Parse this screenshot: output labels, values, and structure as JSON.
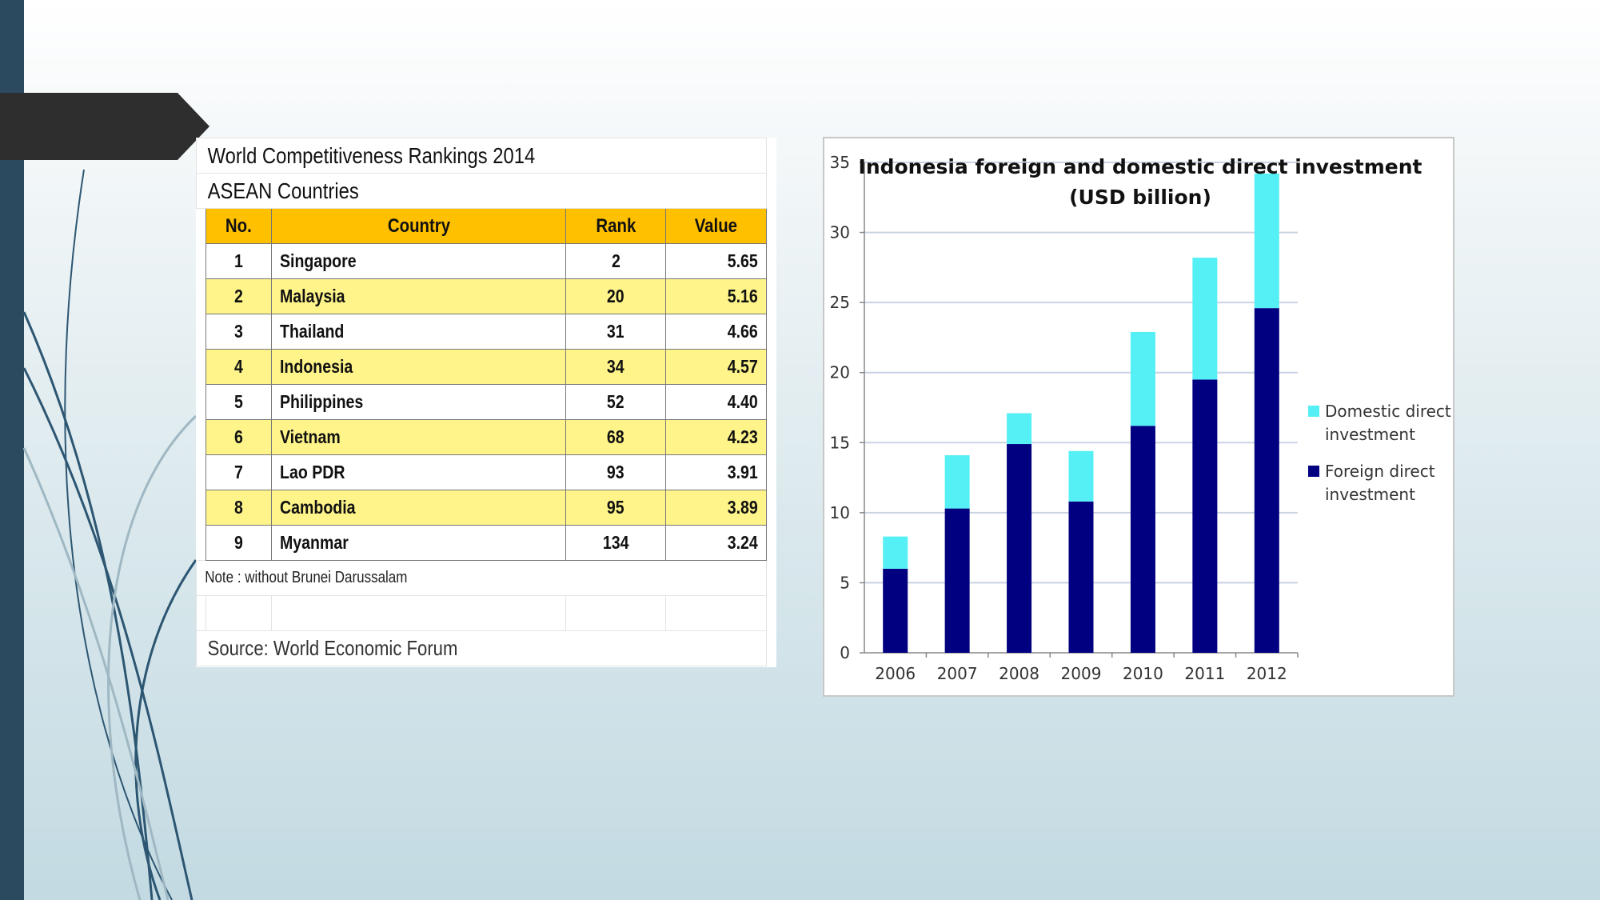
{
  "table": {
    "title": "World Competitiveness Rankings 2014",
    "subtitle": "ASEAN Countries",
    "headers": [
      "No.",
      "Country",
      "Rank",
      "Value"
    ],
    "rows": [
      {
        "no": "1",
        "country": "Singapore",
        "rank": "2",
        "value": "5.65"
      },
      {
        "no": "2",
        "country": "Malaysia",
        "rank": "20",
        "value": "5.16"
      },
      {
        "no": "3",
        "country": "Thailand",
        "rank": "31",
        "value": "4.66"
      },
      {
        "no": "4",
        "country": "Indonesia",
        "rank": "34",
        "value": "4.57"
      },
      {
        "no": "5",
        "country": "Philippines",
        "rank": "52",
        "value": "4.40"
      },
      {
        "no": "6",
        "country": "Vietnam",
        "rank": "68",
        "value": "4.23"
      },
      {
        "no": "7",
        "country": "Lao PDR",
        "rank": "93",
        "value": "3.91"
      },
      {
        "no": "8",
        "country": "Cambodia",
        "rank": "95",
        "value": "3.89"
      },
      {
        "no": "9",
        "country": "Myanmar",
        "rank": "134",
        "value": "3.24"
      }
    ],
    "note": "Note : without Brunei Darussalam",
    "source": "Source: World Economic Forum",
    "header_color": "#ffc000",
    "alt_row_color": "#fef48a"
  },
  "chart_data": {
    "type": "bar",
    "stacked": true,
    "title": [
      "Indonesia foreign and domestic direct investment",
      "(USD billion)"
    ],
    "categories": [
      "2006",
      "2007",
      "2008",
      "2009",
      "2010",
      "2011",
      "2012"
    ],
    "series": [
      {
        "name": "Foreign direct investment",
        "color": "#000080",
        "values": [
          6.0,
          10.3,
          14.9,
          10.8,
          16.2,
          19.5,
          24.6
        ]
      },
      {
        "name": "Domestic direct investment",
        "color": "#55f0f5",
        "values": [
          2.3,
          3.8,
          2.2,
          3.6,
          6.7,
          8.7,
          9.6
        ]
      }
    ],
    "legend": [
      "Domestic direct investment",
      "Foreign direct investment"
    ],
    "ylim": [
      0,
      35
    ],
    "yticks": [
      0,
      5,
      10,
      15,
      20,
      25,
      30,
      35
    ],
    "grid": true,
    "legend_position": "right"
  }
}
